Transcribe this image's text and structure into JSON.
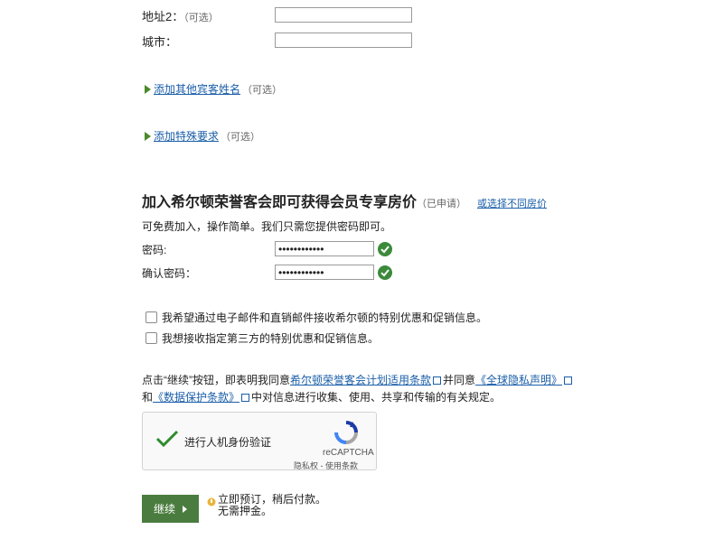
{
  "address2": {
    "label": "地址2：",
    "optional": "（可选）",
    "value": ""
  },
  "city": {
    "label": "城市：",
    "value": ""
  },
  "add_guest": {
    "link": "添加其他宾客姓名",
    "optional": "（可选）"
  },
  "add_request": {
    "link": "添加特殊要求",
    "optional": "（可选）"
  },
  "membership": {
    "heading": "加入希尔顿荣誉客会即可获得会员专享房价",
    "status": "（已申请）",
    "alt_link": "或选择不同房价",
    "desc": "可免费加入，操作简单。我们只需您提供密码即可。"
  },
  "password": {
    "label": "密码:",
    "value": "••••••••••••"
  },
  "confirm_password": {
    "label": "确认密码：",
    "value": "••••••••••••"
  },
  "checkboxes": [
    {
      "label": "我希望通过电子邮件和直销邮件接收希尔顿的特别优惠和促销信息。",
      "checked": false
    },
    {
      "label": "我想接收指定第三方的特别优惠和促销信息。",
      "checked": false
    }
  ],
  "terms": {
    "line1_a": "点击“继续”按钮，即表明我同意",
    "link1": "希尔顿荣誉客会计划适用条款",
    "line1_b": "并同意",
    "link2": "《全球隐私声明》",
    "line2_a": "和",
    "link3": "《数据保护条款》",
    "line2_b": "中对信息进行收集、使用、共享和传输的有关规定。"
  },
  "recaptcha": {
    "label": "进行人机身份验证",
    "brand": "reCAPTCHA",
    "footer": "隐私权 - 使用条款"
  },
  "continue_button": {
    "label": "继续"
  },
  "book_note": {
    "line1": "立即预订，稍后付款。",
    "line2": "无需押金。"
  },
  "colors": {
    "accent_green": "#4a7c3f",
    "link_blue": "#1a5ea8",
    "ok_green": "#3b8a3b"
  }
}
